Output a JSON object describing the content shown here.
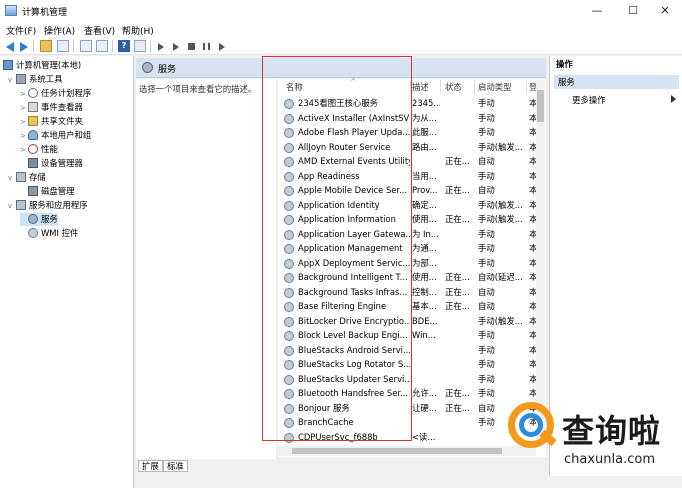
{
  "window": {
    "title": "计算机管理",
    "minimize": "—",
    "maximize": "☐",
    "close": "✕"
  },
  "menu": [
    "文件(F)",
    "操作(A)",
    "查看(V)",
    "帮助(H)"
  ],
  "tree": {
    "root": "计算机管理(本地)",
    "items": [
      {
        "label": "系统工具",
        "level": 1,
        "expand": "v",
        "icon": "tools-icon"
      },
      {
        "label": "任务计划程序",
        "level": 2,
        "expand": ">",
        "icon": "clock-icon"
      },
      {
        "label": "事件查看器",
        "level": 2,
        "expand": ">",
        "icon": "log-icon"
      },
      {
        "label": "共享文件夹",
        "level": 2,
        "expand": ">",
        "icon": "folder-icon"
      },
      {
        "label": "本地用户和组",
        "level": 2,
        "expand": ">",
        "icon": "users-icon"
      },
      {
        "label": "性能",
        "level": 2,
        "expand": ">",
        "icon": "performance-icon"
      },
      {
        "label": "设备管理器",
        "level": 2,
        "expand": "",
        "icon": "device-icon"
      },
      {
        "label": "存储",
        "level": 1,
        "expand": "v",
        "icon": "storage-icon"
      },
      {
        "label": "磁盘管理",
        "level": 2,
        "expand": "",
        "icon": "disk-icon"
      },
      {
        "label": "服务和应用程序",
        "level": 1,
        "expand": "v",
        "icon": "services-apps-icon"
      },
      {
        "label": "服务",
        "level": 2,
        "expand": "",
        "icon": "services-icon"
      },
      {
        "label": "WMI 控件",
        "level": 2,
        "expand": "",
        "icon": "wmi-icon"
      }
    ]
  },
  "services_panel": {
    "title": "服务",
    "description": "选择一个项目来查看它的描述。",
    "columns": [
      "名称",
      "描述",
      "状态",
      "启动类型",
      "登"
    ],
    "sort_arrow": "^",
    "rows": [
      {
        "name": "2345看图王核心服务",
        "desc": "2345...",
        "status": "",
        "startup": "手动",
        "logon": "本"
      },
      {
        "name": "ActiveX Installer (AxInstSV)",
        "desc": "为从...",
        "status": "",
        "startup": "手动",
        "logon": "本"
      },
      {
        "name": "Adobe Flash Player Upda...",
        "desc": "此服...",
        "status": "",
        "startup": "手动",
        "logon": "本"
      },
      {
        "name": "AllJoyn Router Service",
        "desc": "路由...",
        "status": "",
        "startup": "手动(触发...",
        "logon": "本"
      },
      {
        "name": "AMD External Events Utility",
        "desc": "",
        "status": "正在...",
        "startup": "自动",
        "logon": "本"
      },
      {
        "name": "App Readiness",
        "desc": "当用...",
        "status": "",
        "startup": "手动",
        "logon": "本"
      },
      {
        "name": "Apple Mobile Device Ser...",
        "desc": "Prov...",
        "status": "正在...",
        "startup": "自动",
        "logon": "本"
      },
      {
        "name": "Application Identity",
        "desc": "确定...",
        "status": "",
        "startup": "手动(触发...",
        "logon": "本"
      },
      {
        "name": "Application Information",
        "desc": "使用...",
        "status": "正在...",
        "startup": "手动(触发...",
        "logon": "本"
      },
      {
        "name": "Application Layer Gatewa...",
        "desc": "为 In...",
        "status": "",
        "startup": "手动",
        "logon": "本"
      },
      {
        "name": "Application Management",
        "desc": "为通...",
        "status": "",
        "startup": "手动",
        "logon": "本"
      },
      {
        "name": "AppX Deployment Servic...",
        "desc": "为部...",
        "status": "",
        "startup": "手动",
        "logon": "本"
      },
      {
        "name": "Background Intelligent T...",
        "desc": "使用...",
        "status": "正在...",
        "startup": "自动(延迟...",
        "logon": "本"
      },
      {
        "name": "Background Tasks Infras...",
        "desc": "控制...",
        "status": "正在...",
        "startup": "自动",
        "logon": "本"
      },
      {
        "name": "Base Filtering Engine",
        "desc": "基本...",
        "status": "正在...",
        "startup": "自动",
        "logon": "本"
      },
      {
        "name": "BitLocker Drive Encryptio...",
        "desc": "BDE...",
        "status": "",
        "startup": "手动(触发...",
        "logon": "本"
      },
      {
        "name": "Block Level Backup Engi...",
        "desc": "Win...",
        "status": "",
        "startup": "手动",
        "logon": "本"
      },
      {
        "name": "BlueStacks Android Servi...",
        "desc": "",
        "status": "",
        "startup": "手动",
        "logon": "本"
      },
      {
        "name": "BlueStacks Log Rotator S...",
        "desc": "",
        "status": "",
        "startup": "手动",
        "logon": "本"
      },
      {
        "name": "BlueStacks Updater Servi...",
        "desc": "",
        "status": "",
        "startup": "手动",
        "logon": "本"
      },
      {
        "name": "Bluetooth Handsfree Ser...",
        "desc": "允许...",
        "status": "正在...",
        "startup": "手动",
        "logon": "本"
      },
      {
        "name": "Bonjour 服务",
        "desc": "让硬...",
        "status": "正在...",
        "startup": "自动",
        "logon": "本"
      },
      {
        "name": "BranchCache",
        "desc": "",
        "status": "",
        "startup": "手动",
        "logon": "本"
      },
      {
        "name": "CDPUserSvc_f688b",
        "desc": "<读...",
        "status": "",
        "startup": "",
        "logon": ""
      }
    ]
  },
  "tabs": [
    "扩展",
    "标准"
  ],
  "actions": {
    "header": "操作",
    "section": "服务",
    "more": "更多操作"
  },
  "watermark": {
    "name": "查询啦",
    "url": "chaxunla.com"
  },
  "colors": {
    "highlight_box": "#d93030",
    "selection": "#cce4f7",
    "header_bg": "#d5e3f3",
    "watermark_orange": "#f39a1d",
    "watermark_blue": "#2b8be0"
  }
}
